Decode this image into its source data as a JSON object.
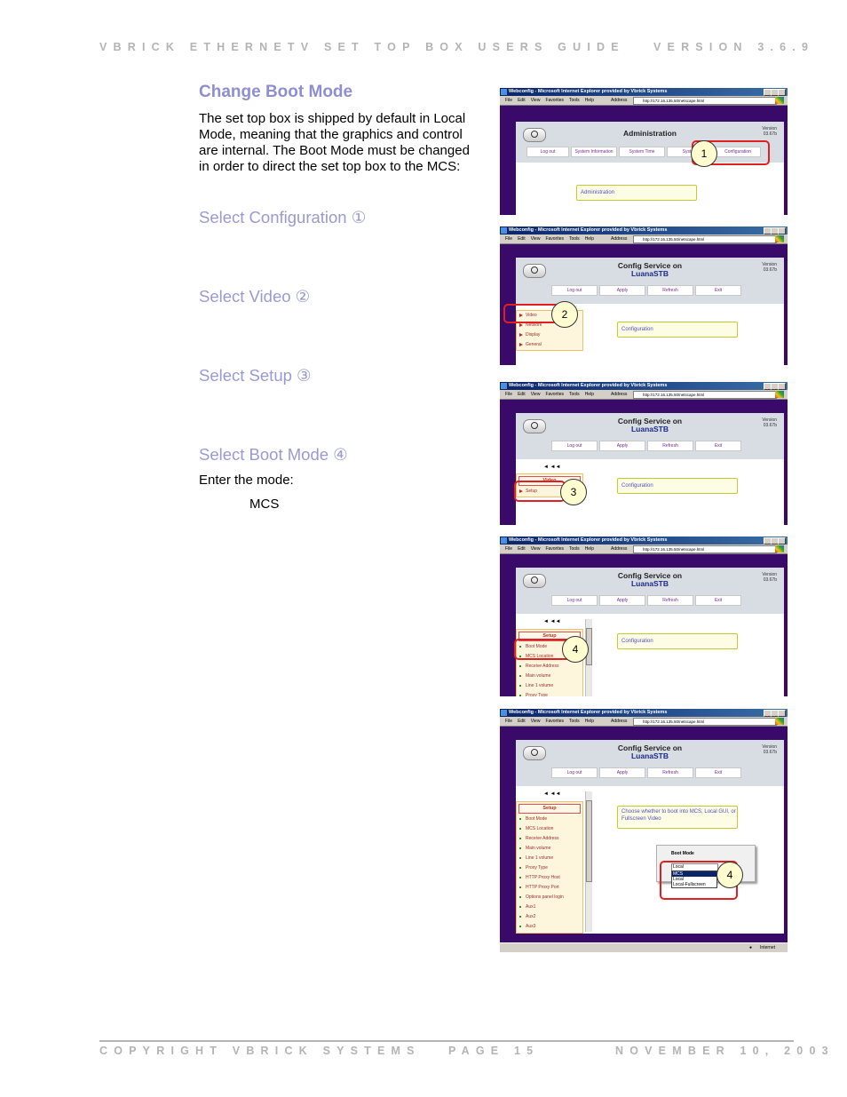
{
  "header": {
    "doc_title": "VBRICK ETHERNETV SET TOP BOX USERS GUIDE",
    "version": "VERSION 3.6.9"
  },
  "footer": {
    "copyright": "COPYRIGHT VBRICK SYSTEMS",
    "page": "PAGE 15",
    "date": "NOVEMBER 10, 2003"
  },
  "section": {
    "title": "Change Boot Mode",
    "intro": "The set top box is shipped by default in Local Mode, meaning that the graphics and control are internal.  The Boot Mode must be changed in order to direct the set top box to the MCS:",
    "steps": [
      {
        "label": "Select Configuration ①"
      },
      {
        "label": "Select Video ②"
      },
      {
        "label": "Select Setup ③"
      },
      {
        "label": "Select Boot Mode ④"
      }
    ],
    "enter_label": "Enter the mode:",
    "mode_value": "MCS"
  },
  "browser": {
    "window_title": "Webconfig - Microsoft Internet Explorer provided by Vbrick Systems",
    "menu": [
      "File",
      "Edit",
      "View",
      "Favorites",
      "Tools",
      "Help"
    ],
    "address_label": "Address",
    "address": "http://172.16.135.50/netscape.html",
    "status_zone": "Internet"
  },
  "webconfig": {
    "version_label": "Version",
    "version_value": "03.67b",
    "admin_title": "Administration",
    "admin_buttons": [
      "Log out",
      "System Information",
      "System Time",
      "System",
      "Configuration"
    ],
    "admin_box": "Administration",
    "config_title_1": "Config Service on",
    "config_title_2": "LuanaSTB",
    "config_buttons": [
      "Log out",
      "Apply",
      "Refresh",
      "Exit"
    ],
    "config_box": "Configuration",
    "nav_root": [
      "Video",
      "Network",
      "Display",
      "General"
    ],
    "nav_back": "◄ ◄◄",
    "nav_video_head": "Video",
    "nav_video_items": [
      "Setup"
    ],
    "nav_setup_head": "Setup",
    "nav_setup_items": [
      "Boot Mode",
      "MCS Location",
      "Receive Address",
      "Main volume",
      "Line 1 volume",
      "Proxy Type",
      "HTTP Proxy Host",
      "HTTP Proxy Port",
      "Options panel login",
      "Aux1",
      "Aux2",
      "Aux3"
    ],
    "boot_help": "Choose whether to boot into MCS, Local GUI, or Fullscreen Video",
    "boot_mode_label": "Boot Mode",
    "boot_mode_current": "Local",
    "boot_mode_options": [
      "MCS",
      "Local",
      "Local-Fullscreen"
    ],
    "boot_mode_highlighted": "MCS"
  },
  "callouts": [
    "1",
    "2",
    "3",
    "4",
    "4"
  ]
}
